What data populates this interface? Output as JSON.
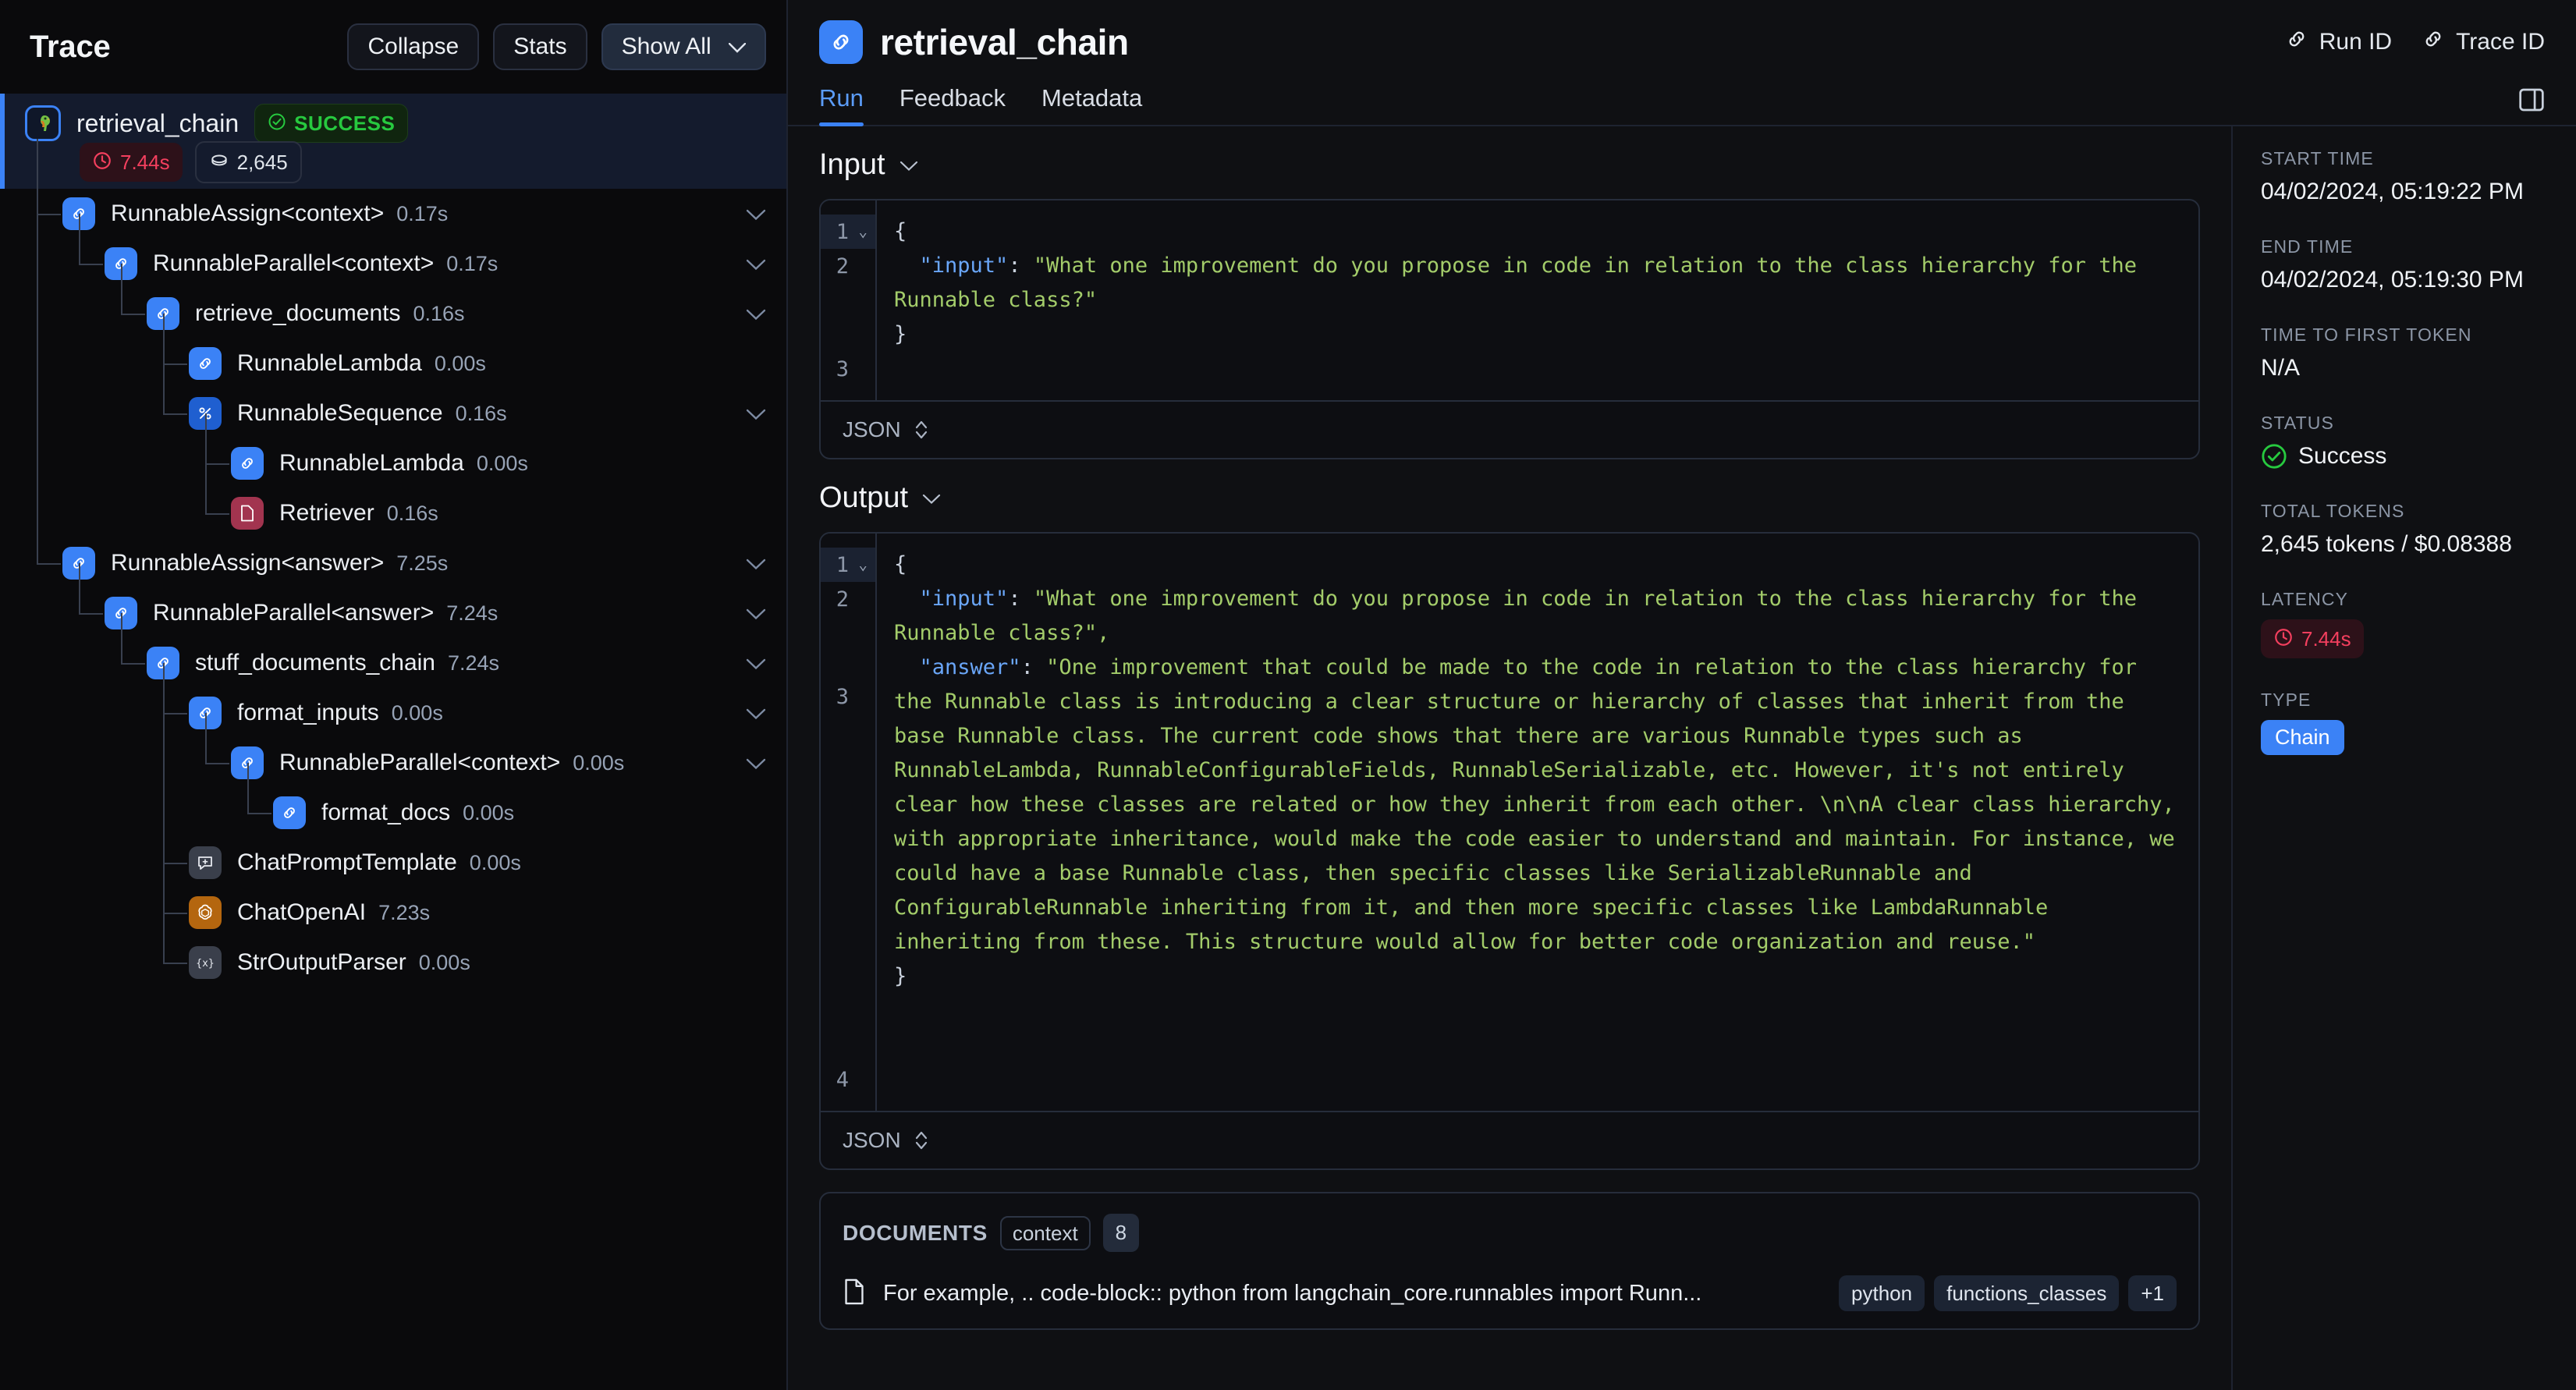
{
  "trace_panel": {
    "title": "Trace",
    "buttons": [
      {
        "label": "Collapse",
        "name": "collapse-button"
      },
      {
        "label": "Stats",
        "name": "stats-button"
      },
      {
        "label": "Show All",
        "name": "show-all-button"
      }
    ],
    "root": {
      "label": "retrieval_chain",
      "status_badge": "SUCCESS",
      "latency_badge": "7.44s",
      "tokens_badge": "2,645",
      "icon": "parrot-icon"
    },
    "nodes": [
      {
        "label": "RunnableAssign<context>",
        "time": "0.17s",
        "depth": 1,
        "icon": "chain-icon",
        "chevron": true
      },
      {
        "label": "RunnableParallel<context>",
        "time": "0.17s",
        "depth": 2,
        "icon": "chain-icon",
        "chevron": true
      },
      {
        "label": "retrieve_documents",
        "time": "0.16s",
        "depth": 3,
        "icon": "chain-icon",
        "chevron": true
      },
      {
        "label": "RunnableLambda",
        "time": "0.00s",
        "depth": 4,
        "icon": "chain-icon",
        "chevron": false
      },
      {
        "label": "RunnableSequence",
        "time": "0.16s",
        "depth": 4,
        "icon": "sequence-icon",
        "chevron": true
      },
      {
        "label": "RunnableLambda",
        "time": "0.00s",
        "depth": 5,
        "icon": "chain-icon",
        "chevron": false
      },
      {
        "label": "Retriever",
        "time": "0.16s",
        "depth": 5,
        "icon": "retriever-icon",
        "chevron": false
      },
      {
        "label": "RunnableAssign<answer>",
        "time": "7.25s",
        "depth": 1,
        "icon": "chain-icon",
        "chevron": true
      },
      {
        "label": "RunnableParallel<answer>",
        "time": "7.24s",
        "depth": 2,
        "icon": "chain-icon",
        "chevron": true
      },
      {
        "label": "stuff_documents_chain",
        "time": "7.24s",
        "depth": 3,
        "icon": "chain-icon",
        "chevron": true
      },
      {
        "label": "format_inputs",
        "time": "0.00s",
        "depth": 4,
        "icon": "chain-icon",
        "chevron": true
      },
      {
        "label": "RunnableParallel<context>",
        "time": "0.00s",
        "depth": 5,
        "icon": "chain-icon",
        "chevron": true
      },
      {
        "label": "format_docs",
        "time": "0.00s",
        "depth": 6,
        "icon": "chain-icon",
        "chevron": false
      },
      {
        "label": "ChatPromptTemplate",
        "time": "0.00s",
        "depth": 4,
        "icon": "prompt-template-icon",
        "chevron": false
      },
      {
        "label": "ChatOpenAI",
        "time": "7.23s",
        "depth": 4,
        "icon": "openai-icon",
        "chevron": false
      },
      {
        "label": "StrOutputParser",
        "time": "0.00s",
        "depth": 4,
        "icon": "output-parser-icon",
        "chevron": false
      }
    ]
  },
  "main": {
    "title": "retrieval_chain",
    "title_icon": "chain-icon",
    "header_links": [
      {
        "label": "Run ID",
        "name": "run-id-link",
        "icon": "link-icon"
      },
      {
        "label": "Trace ID",
        "name": "trace-id-link",
        "icon": "link-icon"
      }
    ],
    "tabs": [
      {
        "label": "Run",
        "active": true
      },
      {
        "label": "Feedback",
        "active": false
      },
      {
        "label": "Metadata",
        "active": false
      }
    ],
    "input": {
      "title": "Input",
      "format": "JSON",
      "lines": [
        "1",
        "2",
        "3"
      ],
      "brace_open": "{",
      "key": "\"input\"",
      "colon": ": ",
      "value": "\"What one improvement do you propose in code in relation to the class hierarchy for the Runnable class?\"",
      "brace_close": "}"
    },
    "output": {
      "title": "Output",
      "format": "JSON",
      "lines": [
        "1",
        "2",
        "3",
        "4"
      ],
      "brace_open": "{",
      "key1": "\"input\"",
      "value1": "\"What one improvement do you propose in code in relation to the class hierarchy for the Runnable class?\",",
      "key2": "\"answer\"",
      "value2": "\"One improvement that could be made to the code in relation to the class hierarchy for the Runnable class is introducing a clear structure or hierarchy of classes that inherit from the base Runnable class. The current code shows that there are various Runnable types such as RunnableLambda, RunnableConfigurableFields, RunnableSerializable, etc. However, it's not entirely clear how these classes are related or how they inherit from each other. \\n\\nA clear class hierarchy, with appropriate inheritance, would make the code easier to understand and maintain. For instance, we could have a base Runnable class, then specific classes like SerializableRunnable and ConfigurableRunnable inheriting from it, and then more specific classes like LambdaRunnable inheriting from these. This structure would allow for better code organization and reuse.\"",
      "brace_close": "}"
    },
    "documents": {
      "label": "DOCUMENTS",
      "chip": "context",
      "count": "8",
      "rows": [
        {
          "text": "For example, .. code-block:: python from langchain_core.runnables import Runn...",
          "tags": [
            "python",
            "functions_classes",
            "+1"
          ]
        }
      ]
    }
  },
  "meta": {
    "groups": [
      {
        "label": "START TIME",
        "value": "04/02/2024, 05:19:22 PM",
        "kind": "text"
      },
      {
        "label": "END TIME",
        "value": "04/02/2024, 05:19:30 PM",
        "kind": "text"
      },
      {
        "label": "TIME TO FIRST TOKEN",
        "value": "N/A",
        "kind": "text"
      },
      {
        "label": "STATUS",
        "value": "Success",
        "kind": "status"
      },
      {
        "label": "TOTAL TOKENS",
        "value": "2,645 tokens / $0.08388",
        "kind": "text"
      },
      {
        "label": "LATENCY",
        "value": "7.44s",
        "kind": "latency"
      },
      {
        "label": "TYPE",
        "value": "Chain",
        "kind": "pill"
      }
    ]
  },
  "colors": {
    "accent": "#3b82f6",
    "success": "#27c93f",
    "danger": "#f43f5e",
    "string": "#a3cc6a",
    "key": "#6aa6f8",
    "bg": "#0a0a0c"
  }
}
